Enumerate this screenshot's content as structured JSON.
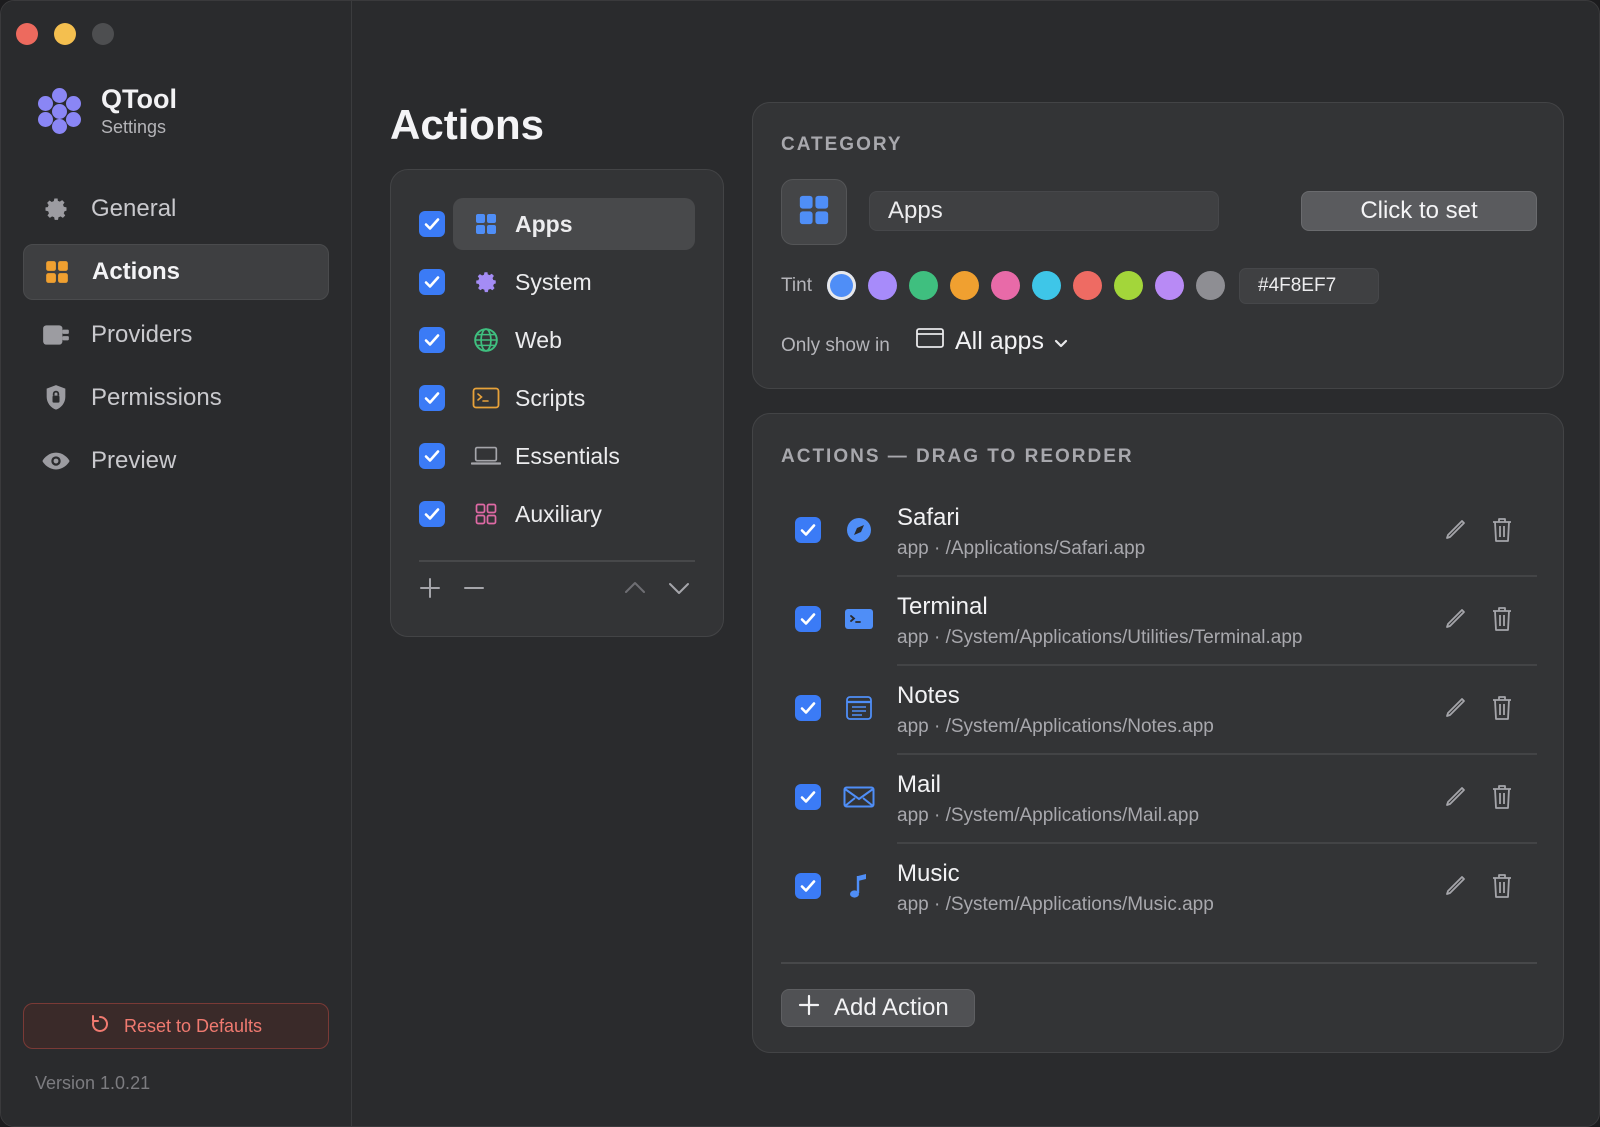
{
  "app": {
    "title": "QTool",
    "subtitle": "Settings"
  },
  "sidebar": {
    "items": [
      {
        "label": "General",
        "icon": "gear-icon",
        "active": false
      },
      {
        "label": "Actions",
        "icon": "grid-icon",
        "active": true
      },
      {
        "label": "Providers",
        "icon": "plug-icon",
        "active": false
      },
      {
        "label": "Permissions",
        "icon": "shield-icon",
        "active": false
      },
      {
        "label": "Preview",
        "icon": "eye-icon",
        "active": false
      }
    ],
    "reset_label": "Reset to Defaults",
    "version": "Version 1.0.21"
  },
  "main": {
    "title": "Actions",
    "categories": [
      {
        "label": "Apps",
        "icon": "grid-icon",
        "checked": true,
        "selected": true,
        "color": "#4F8EF7"
      },
      {
        "label": "System",
        "icon": "gear-icon",
        "checked": true,
        "selected": false,
        "color": "#a48cf5"
      },
      {
        "label": "Web",
        "icon": "globe-icon",
        "checked": true,
        "selected": false,
        "color": "#3fbf7f"
      },
      {
        "label": "Scripts",
        "icon": "terminal-icon",
        "checked": true,
        "selected": false,
        "color": "#e8a23a"
      },
      {
        "label": "Essentials",
        "icon": "laptop-icon",
        "checked": true,
        "selected": false,
        "color": "#a5a5aa"
      },
      {
        "label": "Auxiliary",
        "icon": "squares-icon",
        "checked": true,
        "selected": false,
        "color": "#e06aa5"
      }
    ]
  },
  "category_panel": {
    "header": "CATEGORY",
    "name_value": "Apps",
    "set_button": "Click to set",
    "tint_label": "Tint",
    "swatches": [
      "#4F8EF7",
      "#a78bfa",
      "#3fbf7f",
      "#f0a030",
      "#e86aa8",
      "#3ec6e8",
      "#ee6b63",
      "#a3d63a",
      "#b88af5",
      "#8e8e93"
    ],
    "hex_value": "#4F8EF7",
    "only_show_label": "Only show in",
    "only_show_value": "All apps"
  },
  "actions_panel": {
    "header": "ACTIONS — DRAG TO REORDER",
    "items": [
      {
        "name": "Safari",
        "path": "app · /Applications/Safari.app",
        "icon": "compass-icon"
      },
      {
        "name": "Terminal",
        "path": "app · /System/Applications/Utilities/Terminal.app",
        "icon": "terminal-icon"
      },
      {
        "name": "Notes",
        "path": "app · /System/Applications/Notes.app",
        "icon": "notes-icon"
      },
      {
        "name": "Mail",
        "path": "app · /System/Applications/Mail.app",
        "icon": "mail-icon"
      },
      {
        "name": "Music",
        "path": "app · /System/Applications/Music.app",
        "icon": "music-icon"
      }
    ],
    "add_label": "Add Action"
  },
  "colors": {
    "accent": "#4F8EF7",
    "danger": "#f07a70",
    "brand": "#8a86f5"
  }
}
